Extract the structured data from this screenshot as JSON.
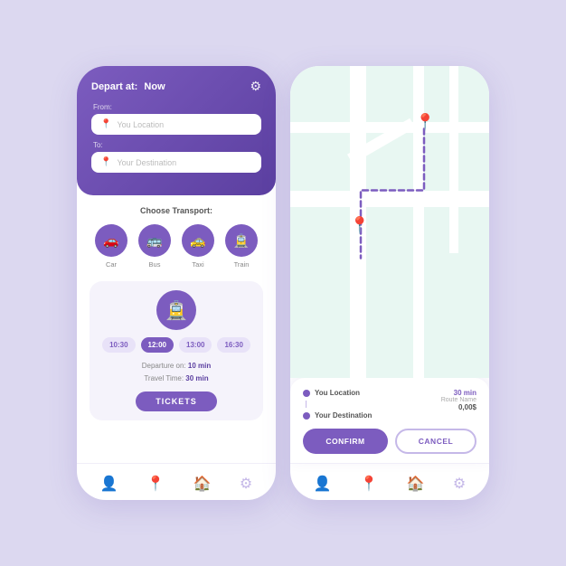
{
  "app": {
    "background": "#dcd8f0",
    "accent": "#7c5cbf"
  },
  "leftPhone": {
    "header": {
      "depart_label": "Depart at:",
      "depart_value": "Now",
      "from_label": "From:",
      "from_placeholder": "You Location",
      "to_label": "To:",
      "to_placeholder": "Your Destination"
    },
    "transport": {
      "title": "Choose Transport:",
      "items": [
        {
          "label": "Car",
          "icon": "🚗"
        },
        {
          "label": "Bus",
          "icon": "🚌"
        },
        {
          "label": "Taxi",
          "icon": "🚕"
        },
        {
          "label": "Train",
          "icon": "🚊"
        }
      ]
    },
    "selected": {
      "icon": "🚊",
      "time_slots": [
        "10:30",
        "12:00",
        "13:00",
        "16:30"
      ],
      "active_slot": "12:00",
      "departure_label": "Departure on:",
      "departure_value": "10 min",
      "travel_label": "Travel Time:",
      "travel_value": "30 min",
      "tickets_btn": "TICKETS"
    },
    "nav": {
      "items": [
        {
          "icon": "👤",
          "label": "profile"
        },
        {
          "icon": "📍",
          "label": "location"
        },
        {
          "icon": "🏠",
          "label": "home"
        },
        {
          "icon": "⚙",
          "label": "settings"
        }
      ]
    }
  },
  "rightPhone": {
    "route_card": {
      "from": "You Location",
      "to": "Your Destination",
      "time": "30 min",
      "route_name": "Route Name",
      "price": "0,00$",
      "confirm_btn": "CONFIRM",
      "cancel_btn": "CANCEL"
    },
    "nav": {
      "items": [
        {
          "icon": "👤",
          "label": "profile"
        },
        {
          "icon": "📍",
          "label": "location"
        },
        {
          "icon": "🏠",
          "label": "home"
        },
        {
          "icon": "⚙",
          "label": "settings"
        }
      ]
    }
  }
}
